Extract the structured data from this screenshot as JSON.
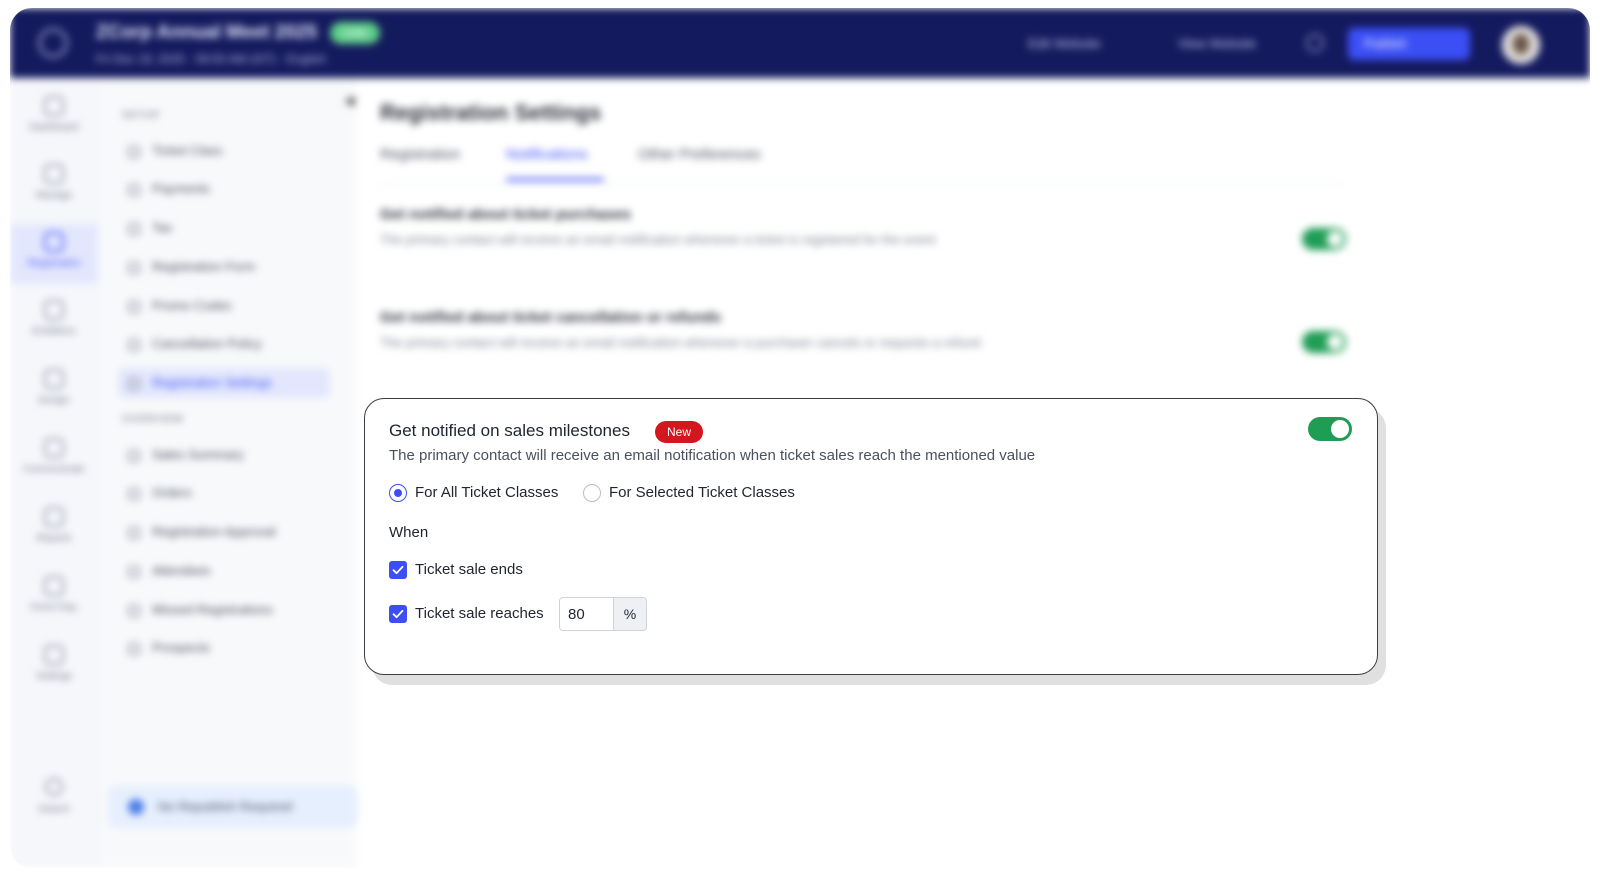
{
  "topbar": {
    "event_title": "ZCorp Annual Meet 2025",
    "status_badge": "Live",
    "event_meta": "Fri Dec 19, 2025 · 09:00 AM (IST)  ·  English",
    "edit_website": "Edit Website",
    "view_website": "View Website",
    "publish": "Publish"
  },
  "rail": {
    "items": [
      "Dashboard",
      "Manage",
      "Registration",
      "Exhibitors",
      "Design",
      "Communicate",
      "Reports",
      "Event Day",
      "Settings"
    ],
    "search": "Search"
  },
  "subnav": {
    "setup_heading": "SETUP",
    "setup_items": [
      "Ticket Class",
      "Payments",
      "Tax",
      "Registration Form",
      "Promo Codes",
      "Cancellation Policy",
      "Registration Settings"
    ],
    "overview_heading": "OVERVIEW",
    "overview_items": [
      "Sales Summary",
      "Orders",
      "Registration Approval",
      "Attendees",
      "Missed Registrations",
      "Prospects"
    ],
    "republish": "No Republish Required"
  },
  "page": {
    "title": "Registration Settings",
    "tabs": [
      "Registration",
      "Notifications",
      "Other Preferences"
    ]
  },
  "settings_bg": [
    {
      "title": "Get notified about ticket purchases",
      "desc": "The primary contact will receive an email notification whenever a ticket is registered for the event"
    },
    {
      "title": "Get notified about ticket cancellation or refunds",
      "desc": "The primary contact will receive an email notification whenever a purchaser cancels or requests a refund"
    }
  ],
  "milestone": {
    "title": "Get notified on sales milestones",
    "badge": "New",
    "description": "The primary contact will receive an email notification when ticket sales reach the mentioned value",
    "enabled": true,
    "radio_all": "For All Ticket Classes",
    "radio_selected": "For Selected Ticket Classes",
    "when_label": "When",
    "check_ends": "Ticket sale ends",
    "check_reaches": "Ticket sale reaches",
    "reach_value": "80",
    "reach_unit": "%"
  },
  "colors": {
    "topbar": "#141a5e",
    "accent": "#3b4ff5",
    "toggle_on": "#1f9d55",
    "badge_new": "#d2171f"
  }
}
